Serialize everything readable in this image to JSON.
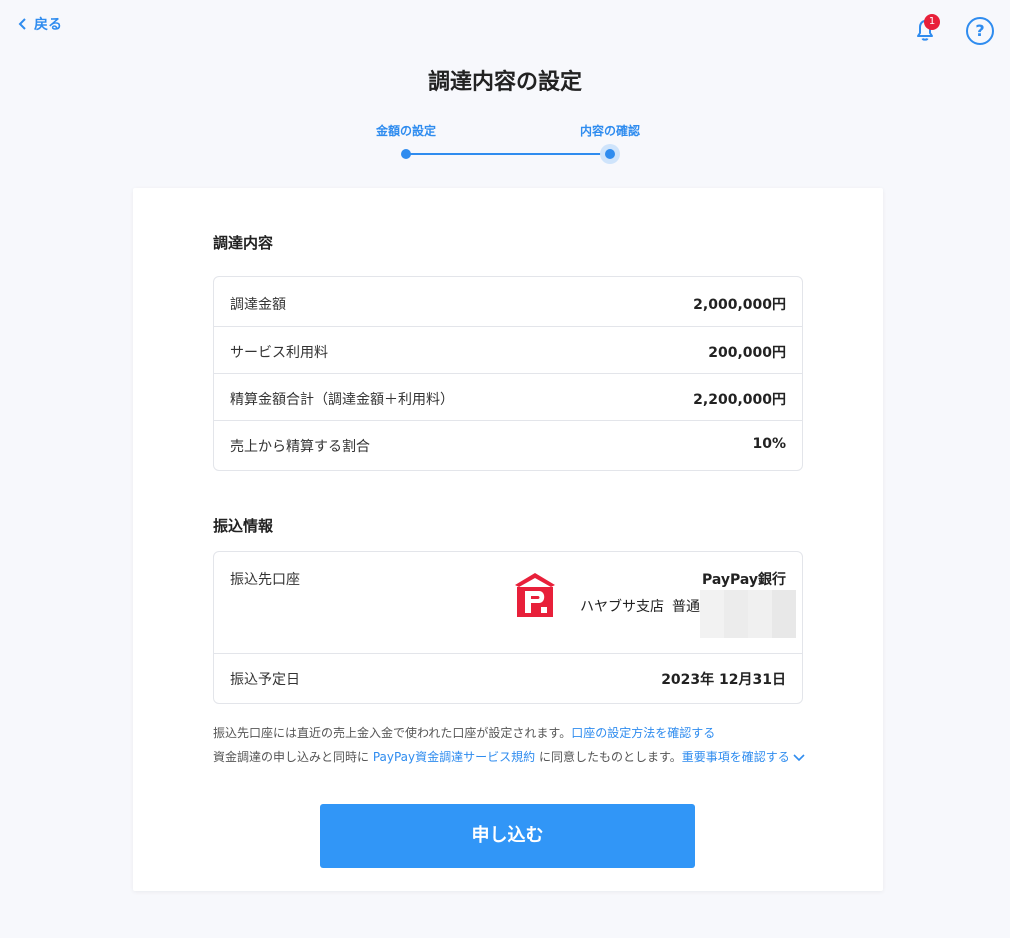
{
  "header": {
    "back_label": "戻る",
    "notification_count": "1",
    "help_label": "?"
  },
  "title": "調達内容の設定",
  "stepper": {
    "steps": [
      {
        "label": "金額の設定",
        "state": "done"
      },
      {
        "label": "内容の確認",
        "state": "current"
      }
    ]
  },
  "procurement": {
    "section_title": "調達内容",
    "rows": [
      {
        "label": "調達金額",
        "value": "2,000,000円"
      },
      {
        "label": "サービス利用料",
        "value": "200,000円"
      },
      {
        "label": "精算金額合計（調達金額＋利用料）",
        "value": "2,200,000円"
      },
      {
        "label": "売上から精算する割合",
        "value": "10%"
      }
    ]
  },
  "transfer": {
    "section_title": "振込情報",
    "account_label": "振込先口座",
    "bank_name": "PayPay銀行",
    "branch": "ハヤブサ支店",
    "account_type": "普通",
    "date_label": "振込予定日",
    "date_value": "2023年 12月31日"
  },
  "notes": {
    "line1_text": "振込先口座には直近の売上金入金で使われた口座が設定されます。",
    "line1_link": "口座の設定方法を確認する",
    "line2_prefix": "資金調達の申し込みと同時に ",
    "line2_link": "PayPay資金調達サービス規約",
    "line2_suffix": " に同意したものとします。",
    "line2_link2": "重要事項を確認する"
  },
  "apply_button": "申し込む",
  "colors": {
    "accent": "#2f8cef",
    "button": "#3196f7",
    "badge": "#e8203a",
    "logo_red": "#e8203a"
  },
  "icons": {
    "back": "chevron-left-icon",
    "notification": "bell-icon",
    "help": "question-circle-icon",
    "expand": "chevron-down-icon",
    "bank": "paypay-bank-logo"
  }
}
